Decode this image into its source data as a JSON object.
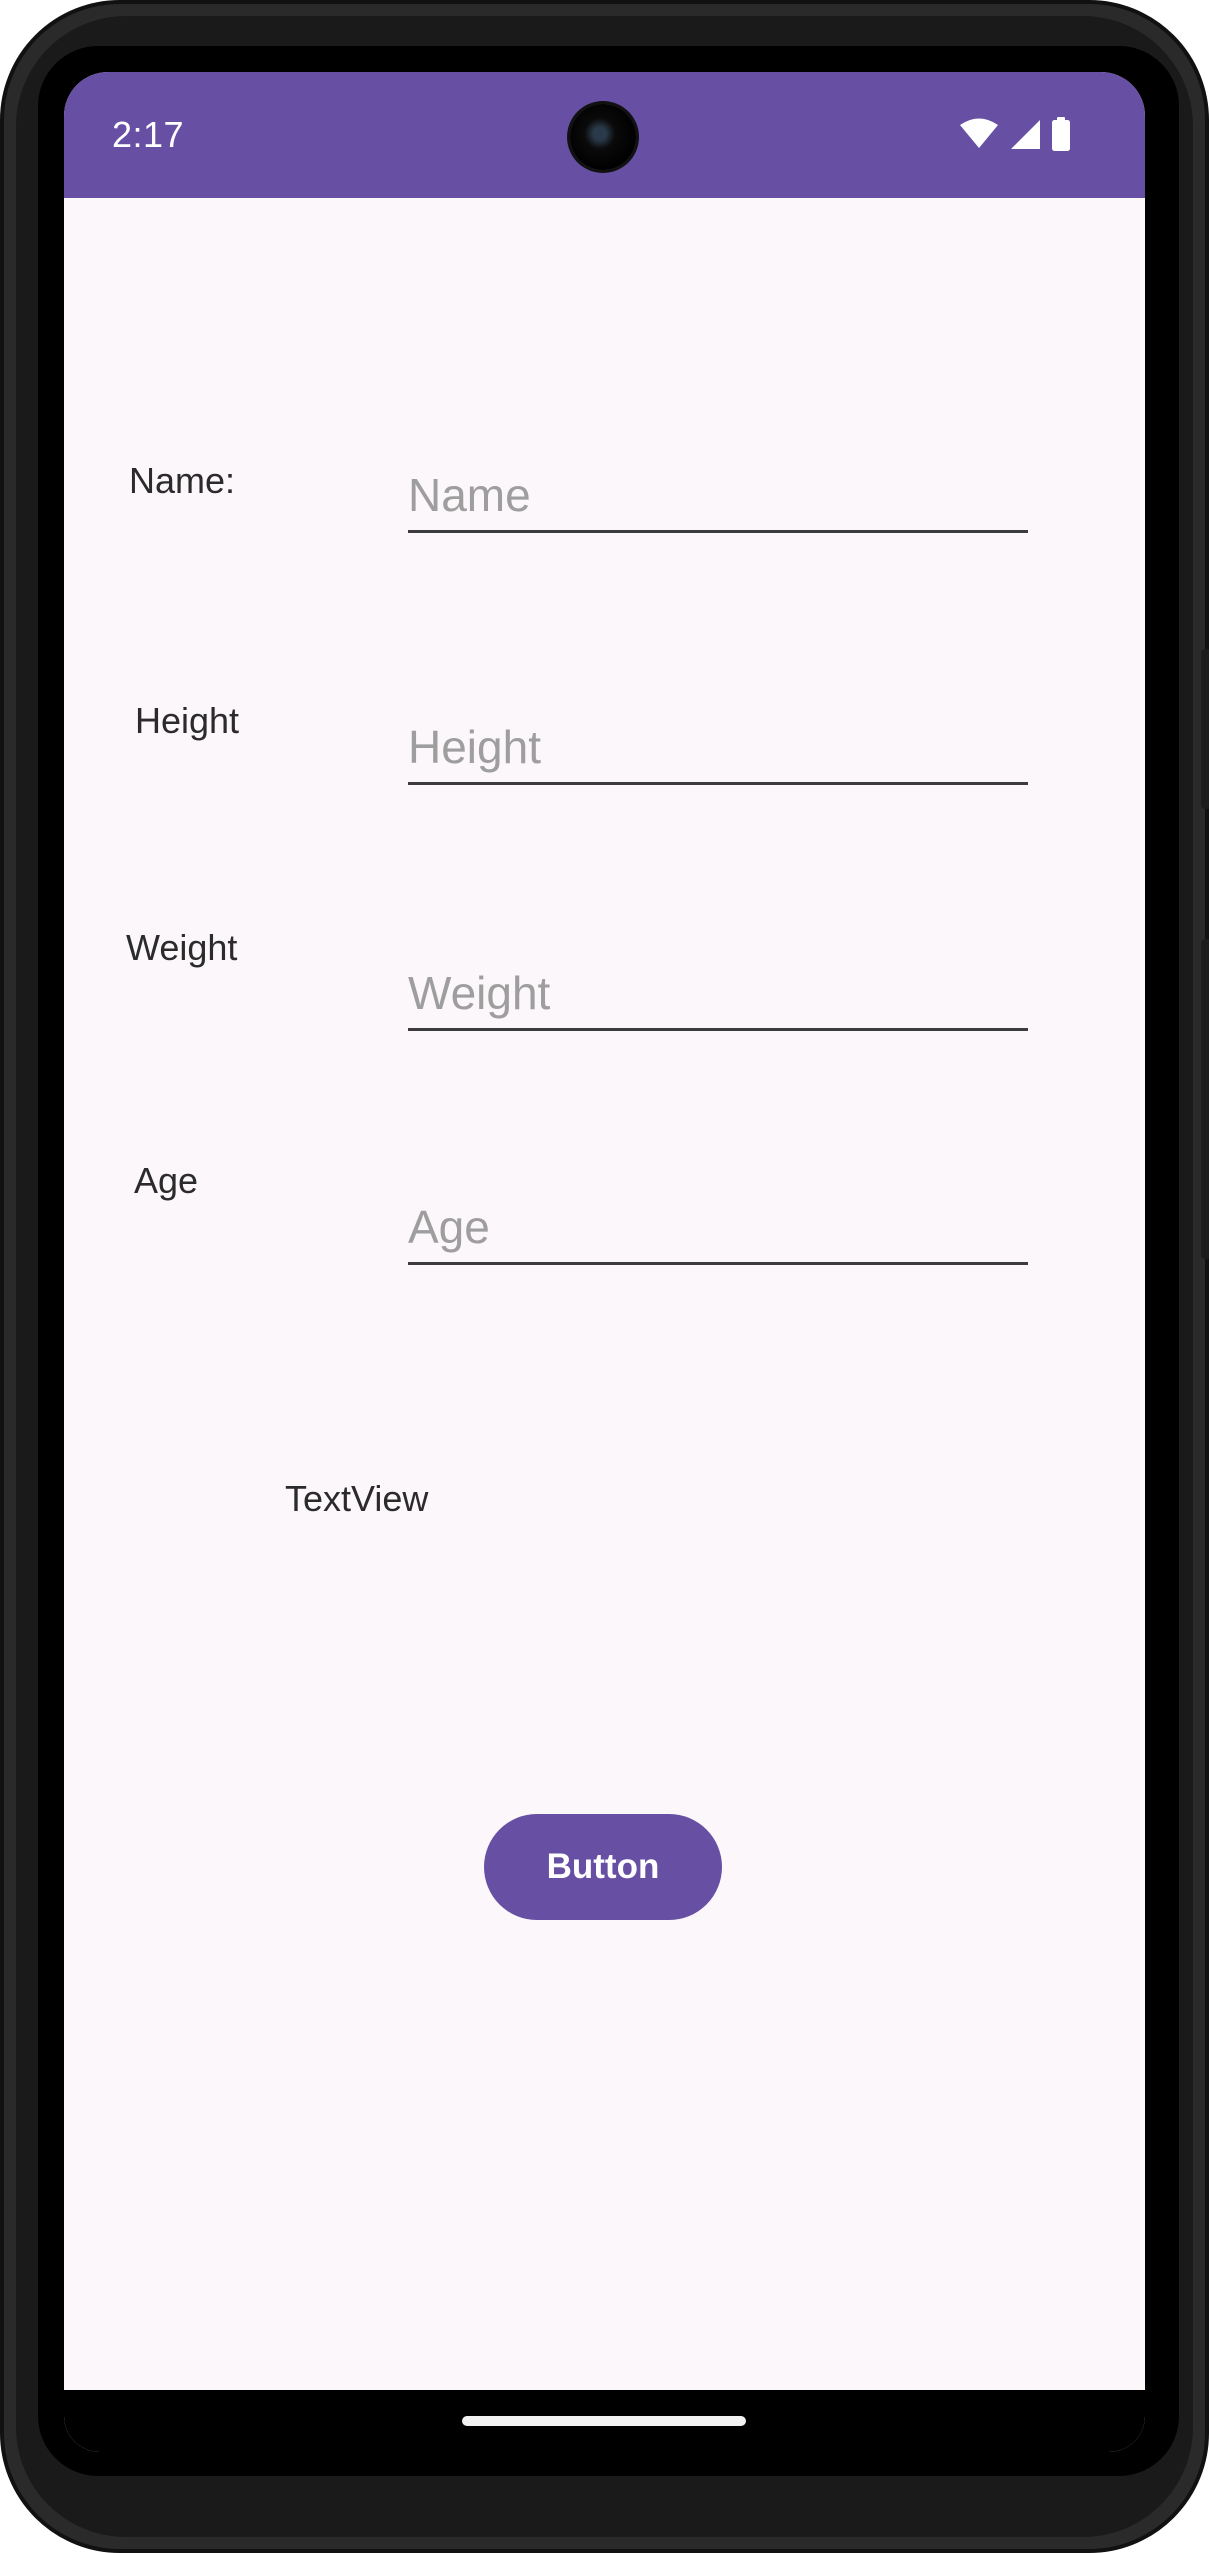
{
  "status_bar": {
    "time": "2:17",
    "icons": [
      "wifi-icon",
      "cell-signal-icon",
      "battery-icon"
    ],
    "background": "#6750a4"
  },
  "form": {
    "name": {
      "label": "Name:",
      "placeholder": "Name"
    },
    "height": {
      "label": "Height",
      "placeholder": "Height"
    },
    "weight": {
      "label": "Weight",
      "placeholder": "Weight"
    },
    "age": {
      "label": "Age",
      "placeholder": "Age"
    }
  },
  "result": {
    "text": "TextView"
  },
  "actions": {
    "button_label": "Button",
    "accent": "#6750a4"
  },
  "colors": {
    "screen_background": "#fcf7fa"
  }
}
